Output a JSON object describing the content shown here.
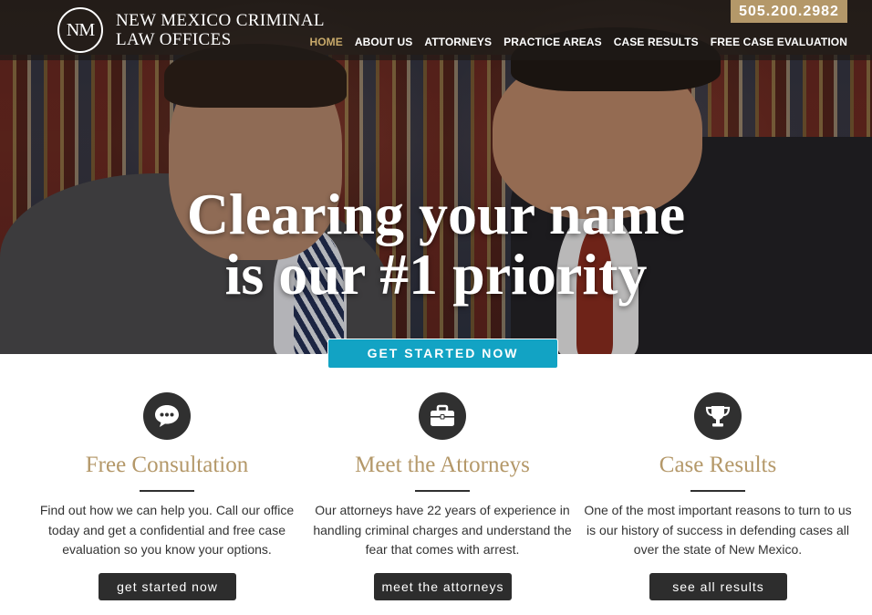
{
  "brand": {
    "logo_monogram": "NM",
    "name_line1": "NEW MEXICO CRIMINAL",
    "name_line2": "LAW OFFICES",
    "phone": "505.200.2982",
    "accent_color": "#b49869",
    "cta_color": "#12a3c4"
  },
  "nav": {
    "items": [
      {
        "label": "HOME",
        "active": true
      },
      {
        "label": "ABOUT US"
      },
      {
        "label": "ATTORNEYS"
      },
      {
        "label": "PRACTICE AREAS"
      },
      {
        "label": "CASE RESULTS"
      },
      {
        "label": "FREE CASE EVALUATION"
      }
    ]
  },
  "hero": {
    "title_line1": "Clearing your name",
    "title_line2": "is our #1 priority",
    "cta_label": "GET STARTED NOW"
  },
  "features": [
    {
      "icon": "speech-bubble-icon",
      "title": "Free Consultation",
      "text": "Find out how we can help you. Call our office today and get a confidential and free case evaluation so you know your options.",
      "button": "get started now"
    },
    {
      "icon": "briefcase-icon",
      "title": "Meet the Attorneys",
      "text": "Our attorneys have 22 years of experience in handling criminal charges and understand the fear that comes with arrest.",
      "button": "meet the attorneys"
    },
    {
      "icon": "trophy-icon",
      "title": "Case Results",
      "text": "One of the most important reasons to turn to us is our history of success in defending cases all over the state of New Mexico.",
      "button": "see all results"
    }
  ]
}
